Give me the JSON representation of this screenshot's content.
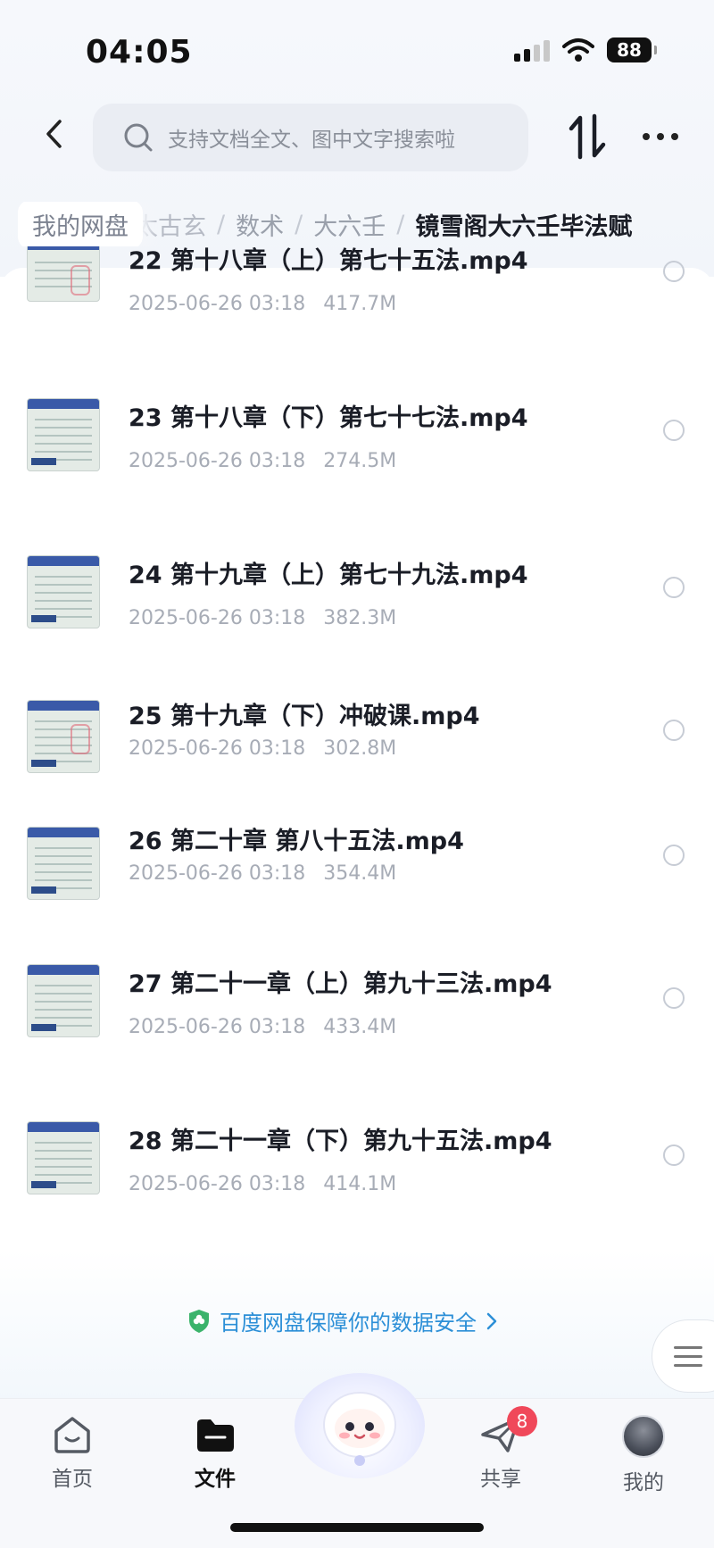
{
  "status_bar": {
    "time": "04:05",
    "battery": "88"
  },
  "header": {
    "search_placeholder": "支持文档全文、图中文字搜索啦"
  },
  "breadcrumb": {
    "home": "我的网盘",
    "items": [
      "太古玄",
      "数术",
      "大六壬"
    ],
    "current": "镜雪阁大六壬毕法赋",
    "separator": "/"
  },
  "files": [
    {
      "name": "22 第十八章（上）第七十五法.mp4",
      "date": "2025-06-26 03:18",
      "size": "417.7M"
    },
    {
      "name": "23 第十八章（下）第七十七法.mp4",
      "date": "2025-06-26 03:18",
      "size": "274.5M"
    },
    {
      "name": "24 第十九章（上）第七十九法.mp4",
      "date": "2025-06-26 03:18",
      "size": "382.3M"
    },
    {
      "name": "25 第十九章（下）冲破课.mp4",
      "date": "2025-06-26 03:18",
      "size": "302.8M"
    },
    {
      "name": "26 第二十章 第八十五法.mp4",
      "date": "2025-06-26 03:18",
      "size": "354.4M"
    },
    {
      "name": "27 第二十一章（上）第九十三法.mp4",
      "date": "2025-06-26 03:18",
      "size": "433.4M"
    },
    {
      "name": "28 第二十一章（下）第九十五法.mp4",
      "date": "2025-06-26 03:18",
      "size": "414.1M"
    }
  ],
  "security_note": "百度网盘保障你的数据安全",
  "tabbar": {
    "home": "首页",
    "files": "文件",
    "share": "共享",
    "share_badge": "8",
    "mine": "我的"
  },
  "colors": {
    "accent_blue": "#2c8fd7",
    "badge_red": "#f0485a"
  }
}
